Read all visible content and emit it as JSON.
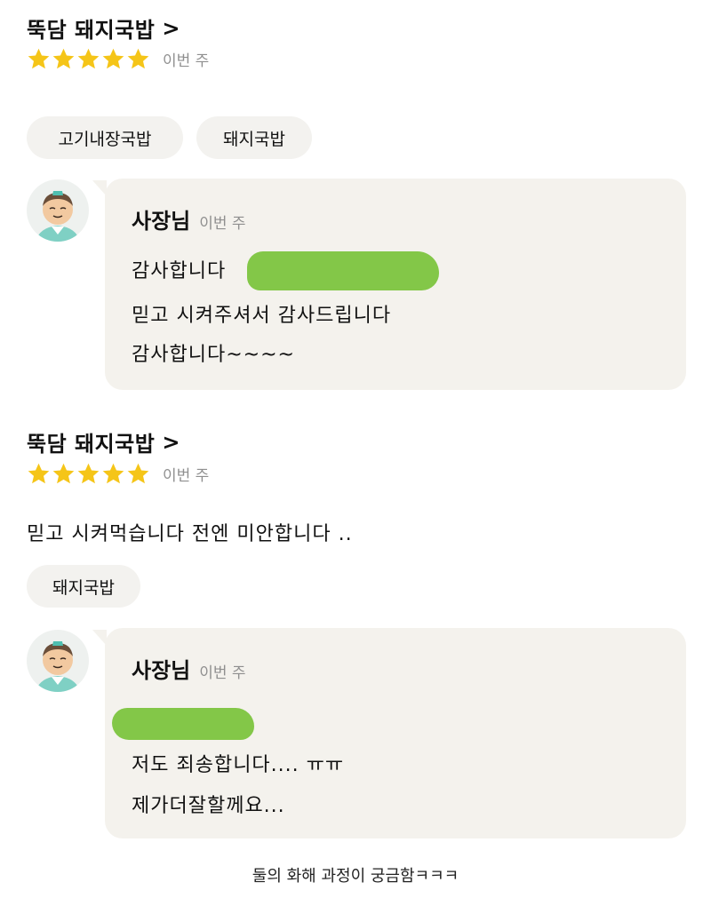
{
  "reviews": [
    {
      "store_name": "뚝담 돼지국밥",
      "chevron": ">",
      "rating": 5,
      "max_rating": 5,
      "date": "이번 주",
      "menu_tags": [
        "고기내장국밥",
        "돼지국밥"
      ],
      "reply": {
        "author": "사장님",
        "date": "이번 주",
        "lines": [
          "감사합니다",
          "믿고 시켜주셔서 감사드립니다",
          "감사합니다~~~~"
        ]
      }
    },
    {
      "store_name": "뚝담 돼지국밥",
      "chevron": ">",
      "rating": 5,
      "max_rating": 5,
      "date": "이번 주",
      "text": "믿고 시켜먹습니다 전엔 미안합니다 ..",
      "menu_tags": [
        "돼지국밥"
      ],
      "reply": {
        "author": "사장님",
        "date": "이번 주",
        "lines": [
          "저도 죄송합니다.... ㅠㅠ",
          "제가더잘할께요..."
        ]
      }
    }
  ],
  "caption": "둘의 화해 과정이 궁금함ㅋㅋㅋ",
  "colors": {
    "star": "#f5c518",
    "bubble": "#f4f2ed",
    "chip": "#f3f2ef",
    "redaction": "#7cc43f",
    "muted_text": "#8f8f8f"
  },
  "icons": {
    "star": "star-icon",
    "avatar": "owner-avatar"
  }
}
